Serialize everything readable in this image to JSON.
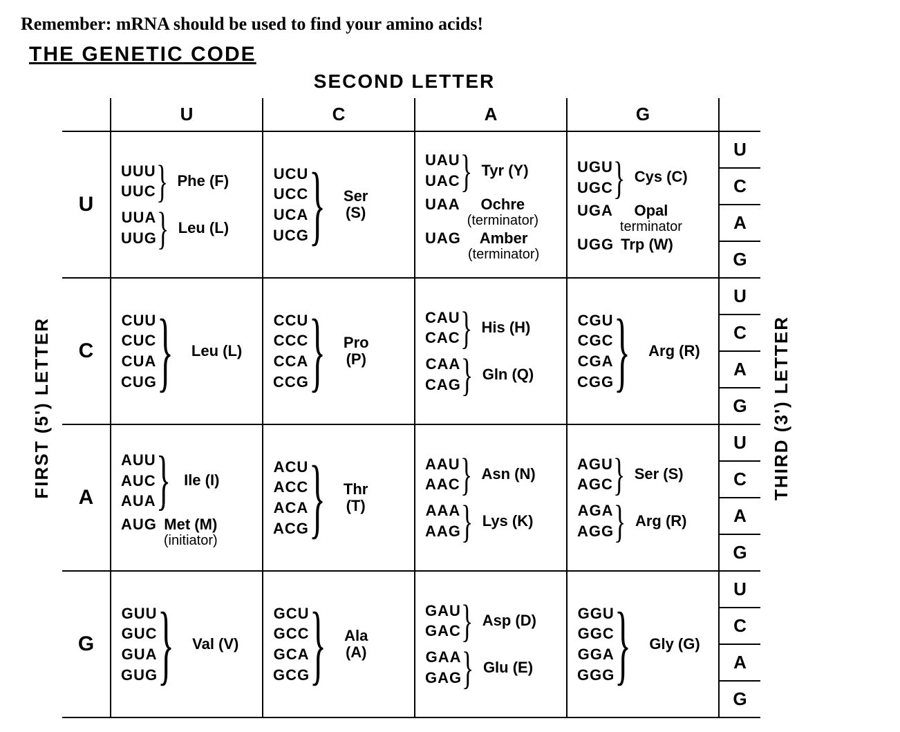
{
  "reminder": "Remember: mRNA should be used to find your amino acids!",
  "title": "THE  GENETIC  CODE",
  "axis": {
    "top": "SECOND  LETTER",
    "left": "FIRST  (5')  LETTER",
    "right": "THIRD  (3')  LETTER"
  },
  "cols": [
    "U",
    "C",
    "A",
    "G"
  ],
  "rows": [
    "U",
    "C",
    "A",
    "G"
  ],
  "third": [
    "U",
    "C",
    "A",
    "G"
  ],
  "cells": {
    "U": {
      "U": [
        {
          "codons": [
            "UUU",
            "UUC"
          ],
          "aa": "Phe (F)"
        },
        {
          "codons": [
            "UUA",
            "UUG"
          ],
          "aa": "Leu (L)"
        }
      ],
      "C": [
        {
          "codons": [
            "UCU",
            "UCC",
            "UCA",
            "UCG"
          ],
          "aa": "Ser",
          "aa2": "(S)"
        }
      ],
      "A": [
        {
          "codons": [
            "UAU",
            "UAC"
          ],
          "aa": "Tyr (Y)"
        },
        {
          "single": "UAA",
          "aa": "Ochre",
          "sub": "(terminator)"
        },
        {
          "single": "UAG",
          "aa": "Amber",
          "sub": "(terminator)"
        }
      ],
      "G": [
        {
          "codons": [
            "UGU",
            "UGC"
          ],
          "aa": "Cys (C)"
        },
        {
          "single": "UGA",
          "aa": "Opal",
          "sub": "terminator"
        },
        {
          "single": "UGG",
          "aa": "Trp (W)"
        }
      ]
    },
    "C": {
      "U": [
        {
          "codons": [
            "CUU",
            "CUC",
            "CUA",
            "CUG"
          ],
          "aa": "Leu (L)"
        }
      ],
      "C": [
        {
          "codons": [
            "CCU",
            "CCC",
            "CCA",
            "CCG"
          ],
          "aa": "Pro",
          "aa2": "(P)"
        }
      ],
      "A": [
        {
          "codons": [
            "CAU",
            "CAC"
          ],
          "aa": "His (H)"
        },
        {
          "codons": [
            "CAA",
            "CAG"
          ],
          "aa": "Gln (Q)"
        }
      ],
      "G": [
        {
          "codons": [
            "CGU",
            "CGC",
            "CGA",
            "CGG"
          ],
          "aa": "Arg (R)"
        }
      ]
    },
    "A": {
      "U": [
        {
          "codons": [
            "AUU",
            "AUC",
            "AUA"
          ],
          "aa": "Ile (I)"
        },
        {
          "single": "AUG",
          "aa": "Met (M)",
          "sub": "(initiator)"
        }
      ],
      "C": [
        {
          "codons": [
            "ACU",
            "ACC",
            "ACA",
            "ACG"
          ],
          "aa": "Thr",
          "aa2": "(T)"
        }
      ],
      "A": [
        {
          "codons": [
            "AAU",
            "AAC"
          ],
          "aa": "Asn (N)"
        },
        {
          "codons": [
            "AAA",
            "AAG"
          ],
          "aa": "Lys (K)"
        }
      ],
      "G": [
        {
          "codons": [
            "AGU",
            "AGC"
          ],
          "aa": "Ser (S)"
        },
        {
          "codons": [
            "AGA",
            "AGG"
          ],
          "aa": "Arg (R)"
        }
      ]
    },
    "G": {
      "U": [
        {
          "codons": [
            "GUU",
            "GUC",
            "GUA",
            "GUG"
          ],
          "aa": "Val (V)"
        }
      ],
      "C": [
        {
          "codons": [
            "GCU",
            "GCC",
            "GCA",
            "GCG"
          ],
          "aa": "Ala",
          "aa2": "(A)"
        }
      ],
      "A": [
        {
          "codons": [
            "GAU",
            "GAC"
          ],
          "aa": "Asp (D)"
        },
        {
          "codons": [
            "GAA",
            "GAG"
          ],
          "aa": "Glu (E)"
        }
      ],
      "G": [
        {
          "codons": [
            "GGU",
            "GGC",
            "GGA",
            "GGG"
          ],
          "aa": "Gly (G)"
        }
      ]
    }
  }
}
